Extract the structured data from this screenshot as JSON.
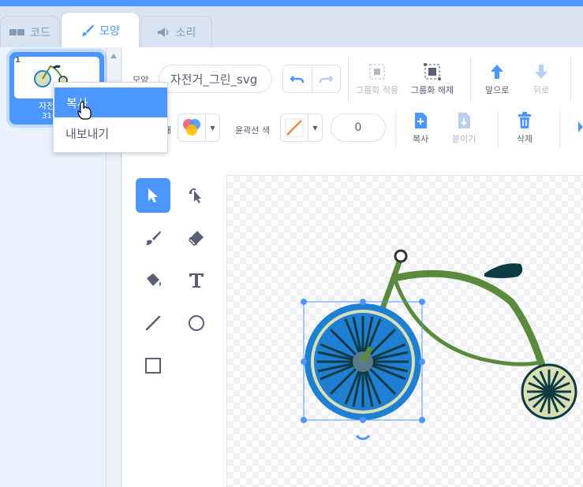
{
  "tabs": [
    {
      "label": "코드",
      "icon": "code-icon"
    },
    {
      "label": "모양",
      "icon": "brush-icon"
    },
    {
      "label": "소리",
      "icon": "speaker-icon"
    }
  ],
  "sprite": {
    "number": "1",
    "name": "자전거_그",
    "size": "316 x 2"
  },
  "context_menu": {
    "items": [
      "복사",
      "내보내기"
    ]
  },
  "toolbar": {
    "costume_label": "모양",
    "costume_name": "자전거_그린_svg",
    "group_label": "그룹화 적용",
    "ungroup_label": "그룹화 해제",
    "forward_label": "앞으로",
    "backward_label": "뒤로",
    "fill_label": "채",
    "outline_label": "윤곽선 색",
    "outline_width": "0",
    "copy_label": "복사",
    "paste_label": "붙이기",
    "delete_label": "삭제"
  },
  "colors": {
    "accent": "#4c97ff",
    "bike_frame": "#5a8a3c",
    "wheel_blue": "#1f7fd3",
    "wheel_fill": "#d9dfb4",
    "seat": "#0e3b43"
  }
}
